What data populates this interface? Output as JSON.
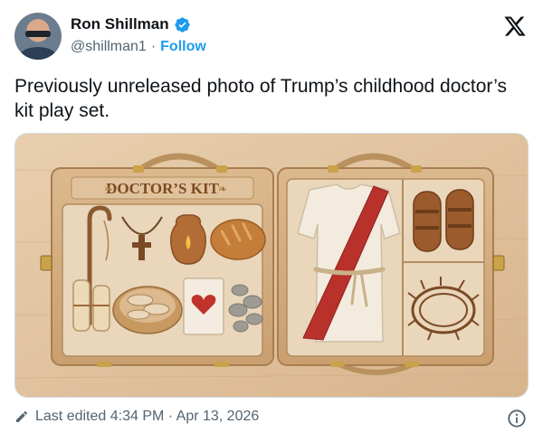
{
  "author": {
    "name": "Ron Shillman",
    "handle": "@shillman1",
    "separator": "·",
    "follow_label": "Follow"
  },
  "tweet": {
    "text": "Previously unreleased photo of Trump’s childhood doctor’s kit play set."
  },
  "media": {
    "case_label": "DOCTOR’S KIT"
  },
  "footer": {
    "edited_text": "Last edited 4:34 PM · Apr 13, 2026"
  },
  "colors": {
    "link_blue": "#1d9bf0",
    "muted_gray": "#536471",
    "verified_blue": "#1d9bf0"
  },
  "icons": [
    "verified-badge-icon",
    "x-logo-icon",
    "pencil-icon",
    "info-icon"
  ]
}
